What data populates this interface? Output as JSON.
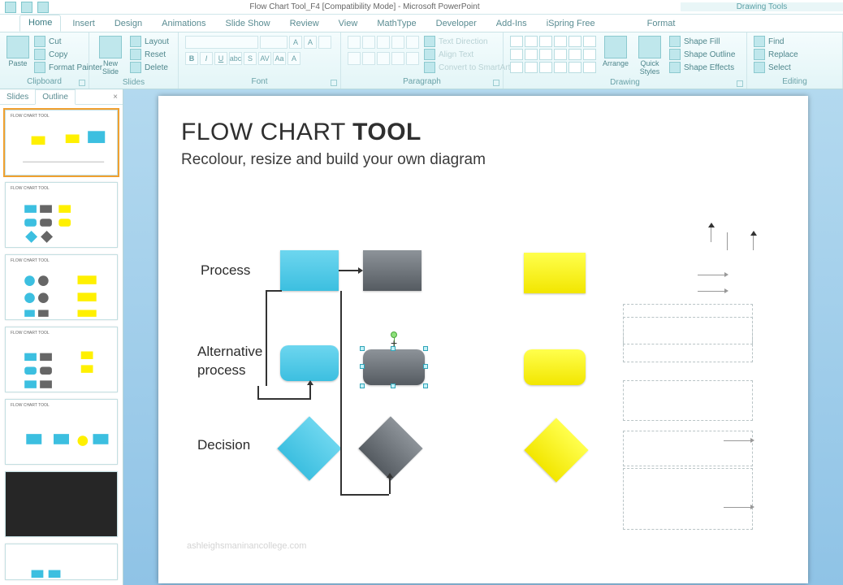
{
  "titlebar": {
    "document": "Flow Chart Tool_F4 [Compatibility Mode] - Microsoft PowerPoint",
    "context_tab": "Drawing Tools"
  },
  "tabs": [
    "Home",
    "Insert",
    "Design",
    "Animations",
    "Slide Show",
    "Review",
    "View",
    "MathType",
    "Developer",
    "Add-Ins",
    "iSpring Free",
    "Format"
  ],
  "active_tab": "Home",
  "ribbon": {
    "clipboard": {
      "label": "Clipboard",
      "paste": "Paste",
      "cut": "Cut",
      "copy": "Copy",
      "format_painter": "Format Painter"
    },
    "slides": {
      "label": "Slides",
      "new_slide": "New Slide",
      "layout": "Layout",
      "reset": "Reset",
      "delete": "Delete"
    },
    "font": {
      "label": "Font"
    },
    "paragraph": {
      "label": "Paragraph",
      "text_direction": "Text Direction",
      "align_text": "Align Text",
      "convert": "Convert to SmartArt"
    },
    "drawing": {
      "label": "Drawing",
      "arrange": "Arrange",
      "quick_styles": "Quick Styles",
      "shape_fill": "Shape Fill",
      "shape_outline": "Shape Outline",
      "shape_effects": "Shape Effects"
    },
    "editing": {
      "label": "Editing",
      "find": "Find",
      "replace": "Replace",
      "select": "Select"
    }
  },
  "slidepane": {
    "tabs": {
      "slides": "Slides",
      "outline": "Outline"
    },
    "thumb_title": "FLOW CHART TOOL"
  },
  "slide": {
    "title_a": "FLOW CHART ",
    "title_b": "TOOL",
    "subtitle": "Recolour, resize and build your own diagram",
    "rows": {
      "r1": "Process",
      "r2a": "Alternative",
      "r2b": "process",
      "r3": "Decision"
    }
  },
  "colors": {
    "cyan": "#44c7e6",
    "gray": "#6b7076",
    "yellow": "#fff000"
  },
  "watermark": "ashleighsmaninancollege.com"
}
